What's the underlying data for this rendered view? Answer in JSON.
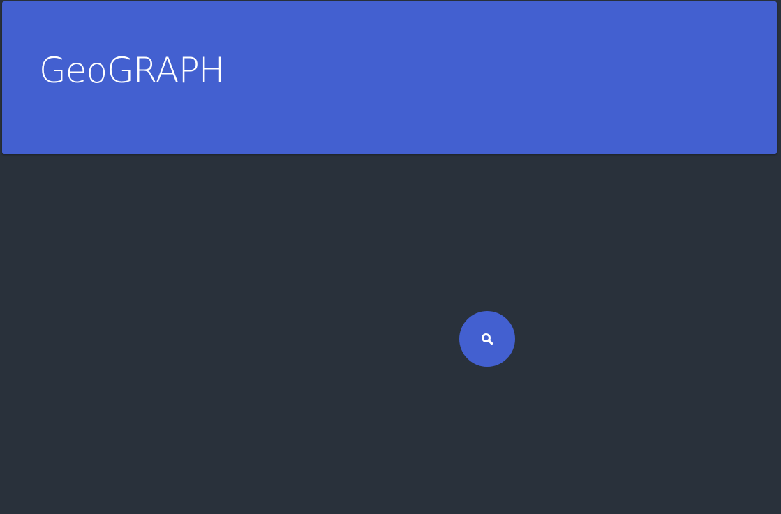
{
  "header": {
    "title": "GeoGRAPH"
  },
  "search_button": {
    "icon": "search-icon"
  },
  "colors": {
    "background": "#29313b",
    "accent": "#4360d0",
    "text": "#ffffff"
  }
}
